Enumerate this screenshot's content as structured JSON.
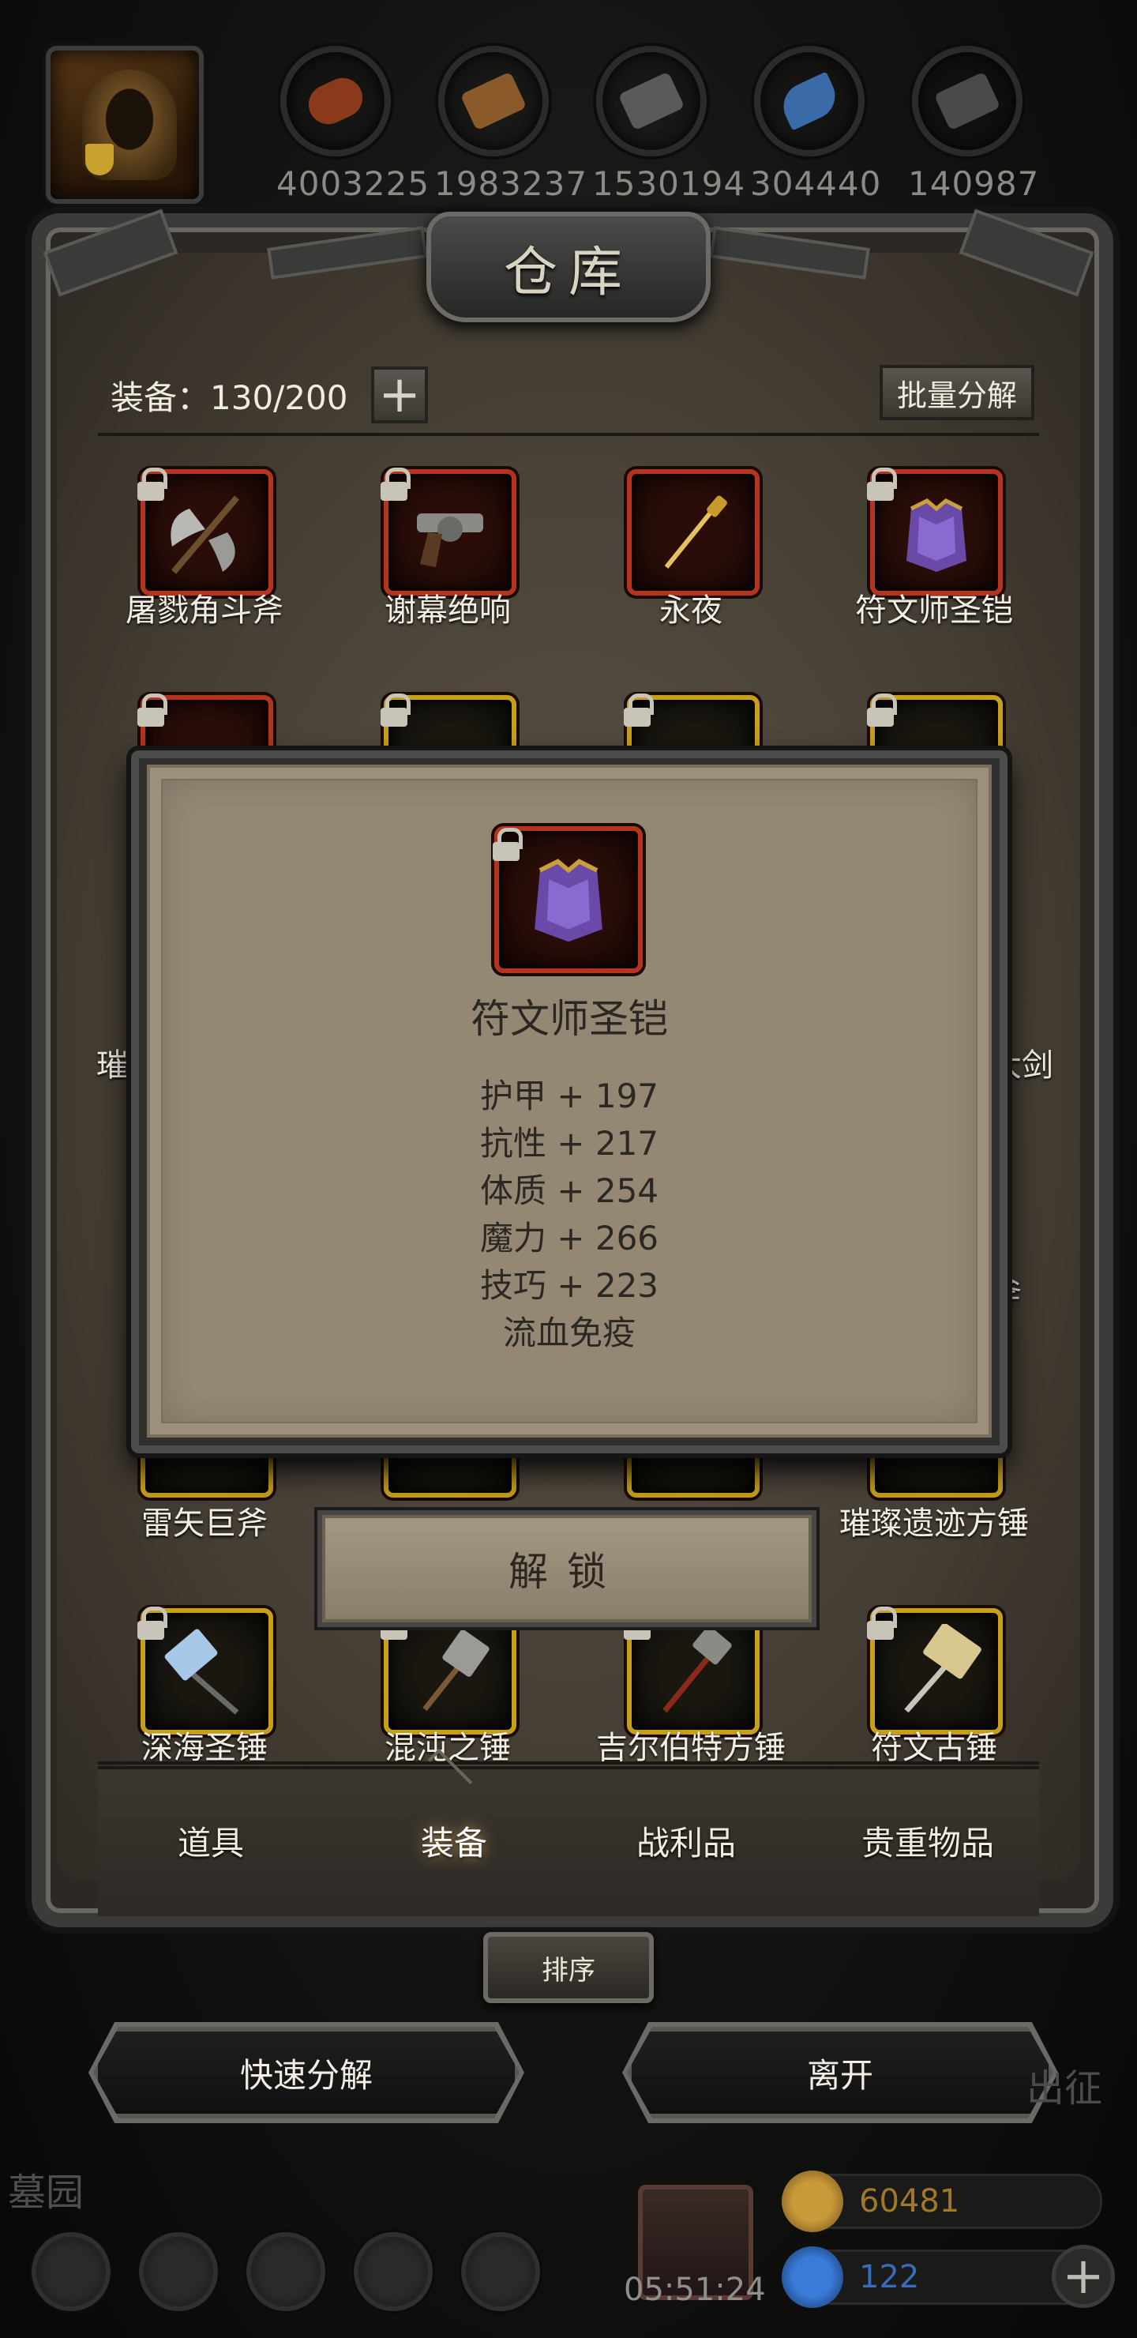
{
  "resources": [
    {
      "icon": "meat-icon",
      "amount": "4003225",
      "color": "#8a3a1a"
    },
    {
      "icon": "wood-icon",
      "amount": "1983237",
      "color": "#8a5a2a"
    },
    {
      "icon": "stone-icon",
      "amount": "1530194",
      "color": "#5a5a58"
    },
    {
      "icon": "crystal-icon",
      "amount": "304440",
      "color": "#3a6aa8"
    },
    {
      "icon": "iron-icon",
      "amount": "140987",
      "color": "#4a4a48"
    }
  ],
  "warehouse": {
    "title": "仓库",
    "capacity_label": "装备：130/200",
    "add_capacity": "+",
    "batch_dismantle": "批量分解"
  },
  "items_row1": [
    {
      "name": "屠戮角斗斧",
      "rarity": "red",
      "icon": "battle-axe-icon"
    },
    {
      "name": "谢幕绝响",
      "rarity": "red",
      "icon": "revolver-icon"
    },
    {
      "name": "永夜",
      "rarity": "red",
      "icon": "dagger-icon"
    },
    {
      "name": "符文师圣铠",
      "rarity": "red",
      "icon": "armor-icon"
    }
  ],
  "items_row2_partial": [
    {
      "name": "璀",
      "rarity": "red"
    },
    {
      "name": "",
      "rarity": "gold"
    },
    {
      "name": "",
      "rarity": "gold"
    },
    {
      "name": "大剑",
      "rarity": "gold"
    }
  ],
  "items_row3_partial": [
    {
      "name": "",
      "rarity": "gold"
    },
    {
      "name": "斧",
      "rarity": "gold"
    }
  ],
  "items_row4": [
    {
      "name": "雷矢巨斧",
      "rarity": "gold"
    },
    {
      "name": "",
      "rarity": "gold"
    },
    {
      "name": "",
      "rarity": "gold"
    },
    {
      "name": "璀璨遗迹方锤",
      "rarity": "gold"
    }
  ],
  "items_row5": [
    {
      "name": "深海圣锤",
      "rarity": "gold",
      "icon": "war-hammer-icon"
    },
    {
      "name": "混沌之锤",
      "rarity": "gold",
      "icon": "war-hammer-icon"
    },
    {
      "name": "吉尔伯特方锤",
      "rarity": "gold",
      "icon": "war-hammer-icon"
    },
    {
      "name": "符文古锤",
      "rarity": "gold",
      "icon": "war-hammer-icon"
    }
  ],
  "tabs": [
    {
      "label": "道具",
      "active": false
    },
    {
      "label": "装备",
      "active": true
    },
    {
      "label": "战利品",
      "active": false
    },
    {
      "label": "贵重物品",
      "active": false
    }
  ],
  "sort_label": "排序",
  "actions": {
    "quick_dismantle": "快速分解",
    "leave": "离开"
  },
  "detail": {
    "name": "符文师圣铠",
    "stats": [
      "护甲 + 197",
      "抗性 + 217",
      "体质 + 254",
      "魔力 + 266",
      "技巧 + 223",
      "流血免疫"
    ],
    "unlock_label": "解锁"
  },
  "hud": {
    "zone": "墓园",
    "expedition": "出征",
    "timer": "05:51:24",
    "gold": "60481",
    "gems": "122",
    "add": "+"
  }
}
